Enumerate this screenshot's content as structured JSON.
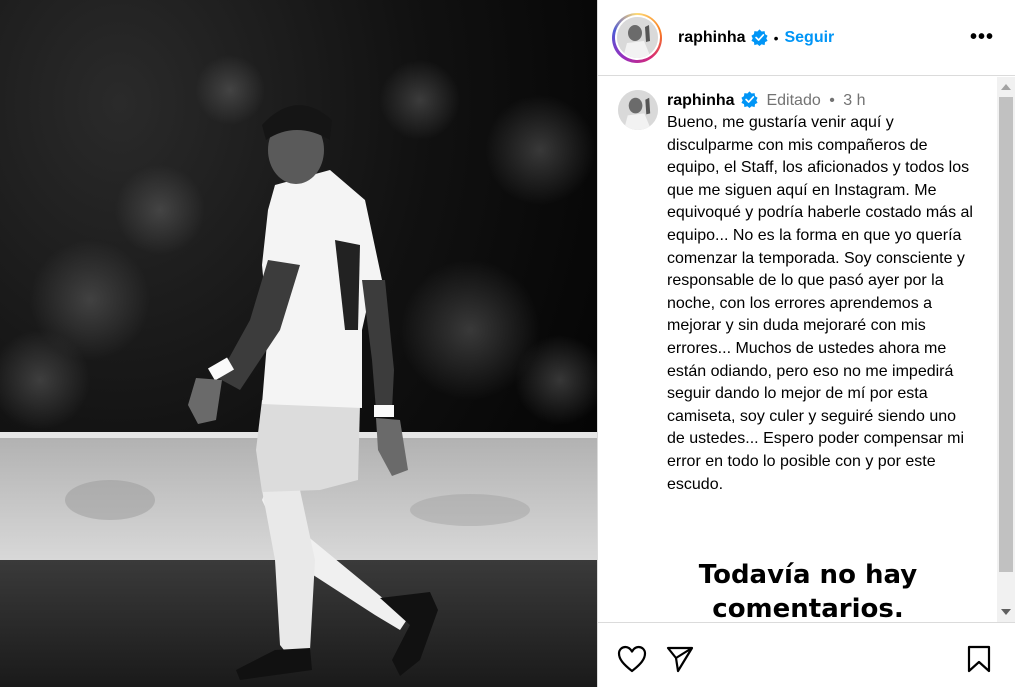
{
  "post": {
    "username": "raphinha",
    "follow_label": "Seguir",
    "header_separator": "•",
    "more_label": "•••",
    "verified_icon": "verified-badge-icon",
    "accent_color": "#0095f6"
  },
  "caption": {
    "username": "raphinha",
    "edited_label": "Editado",
    "separator": "•",
    "time": "3 h",
    "text": "Bueno, me gustaría venir aquí y disculparme con mis compañeros de equipo, el Staff, los aficionados y todos los que me siguen aquí en Instagram. Me equivoqué y podría haberle costado más al equipo... No es la forma en que yo quería comenzar la temporada. Soy consciente y responsable de lo que pasó ayer por la noche, con los errores aprendemos a mejorar y sin duda mejoraré con mis errores... Muchos de ustedes ahora me están odiando, pero eso no me impedirá seguir dando lo mejor de mí por esta camiseta, soy culer y seguiré siendo uno de ustedes... Espero poder compensar mi error en todo lo posible con y por este escudo."
  },
  "comments": {
    "empty_title": "Todavía no hay comentarios."
  },
  "actions": {
    "icons": [
      "heart-icon",
      "share-icon",
      "bookmark-icon"
    ]
  }
}
